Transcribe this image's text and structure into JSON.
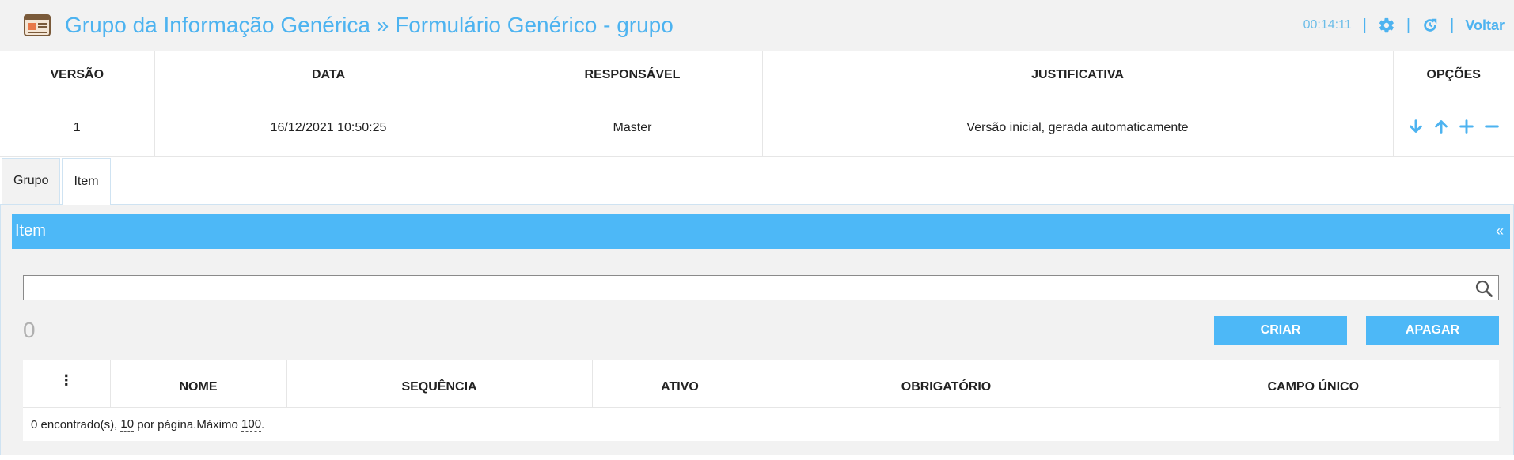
{
  "header": {
    "title": "Grupo da Informação Genérica » Formulário Genérico - grupo",
    "clock": "00:14:11",
    "back_label": "Voltar",
    "icons": [
      "form-icon",
      "gear-icon",
      "refresh-icon"
    ]
  },
  "version_table": {
    "columns": [
      "VERSÃO",
      "DATA",
      "RESPONSÁVEL",
      "JUSTIFICATIVA",
      "OPÇÕES"
    ],
    "rows": [
      {
        "versao": "1",
        "data": "16/12/2021 10:50:25",
        "responsavel": "Master",
        "justificativa": "Versão inicial, gerada automaticamente",
        "opcoes": [
          "arrow-down-icon",
          "arrow-up-icon",
          "plus-icon",
          "minus-icon"
        ]
      }
    ]
  },
  "tabs": [
    {
      "label": "Grupo",
      "active": false
    },
    {
      "label": "Item",
      "active": true
    }
  ],
  "panel": {
    "title": "Item",
    "collapse_symbol": "«",
    "search_value": "",
    "count": "0",
    "create_label": "CRIAR",
    "delete_label": "APAGAR",
    "columns": [
      "⋮",
      "NOME",
      "SEQUÊNCIA",
      "ATIVO",
      "OBRIGATÓRIO",
      "CAMPO ÚNICO"
    ],
    "footer": {
      "found": "0 encontrado(s),",
      "per_page_value": "10",
      "per_page_text": "por página.Máximo",
      "max_value": "100",
      "end": "."
    }
  },
  "colors": {
    "accent": "#4db8f7",
    "title": "#4db3f0",
    "header_bg": "#f2f2f2"
  }
}
